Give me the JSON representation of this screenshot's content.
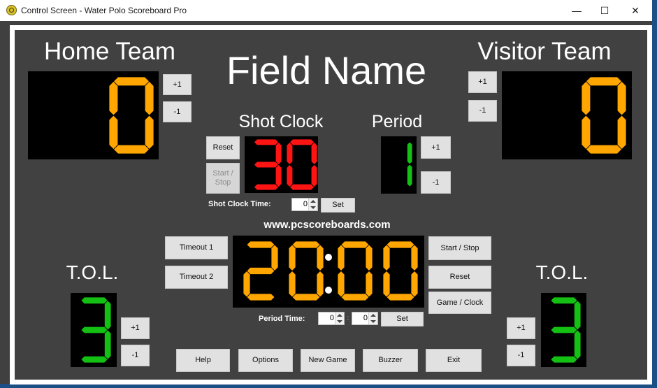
{
  "window": {
    "title": "Control Screen - Water Polo Scoreboard Pro",
    "controls": {
      "minimize": "—",
      "maximize": "☐",
      "close": "✕"
    }
  },
  "colors": {
    "score_digit": "#ffa600",
    "shot_clock_digit": "#ff1414",
    "period_digit": "#13c013",
    "tol_digit": "#13c013",
    "clock_digit": "#ffa600",
    "panel_bg": "#414141",
    "display_bg": "#000000"
  },
  "field_name": "Field Name",
  "home": {
    "label": "Home Team",
    "score": "0",
    "plus_label": "+1",
    "minus_label": "-1",
    "tol_label": "T.O.L.",
    "tol_value": "3",
    "tol_plus_label": "+1",
    "tol_minus_label": "-1"
  },
  "visitor": {
    "label": "Visitor Team",
    "score": "0",
    "plus_label": "+1",
    "minus_label": "-1",
    "tol_label": "T.O.L.",
    "tol_value": "3",
    "tol_plus_label": "+1",
    "tol_minus_label": "-1"
  },
  "shot_clock": {
    "label": "Shot Clock",
    "value": "30",
    "reset_label": "Reset",
    "start_stop_label": "Start / Stop",
    "time_label": "Shot Clock Time:",
    "time_value": "0",
    "set_label": "Set"
  },
  "period": {
    "label": "Period",
    "value": "1",
    "plus_label": "+1",
    "minus_label": "-1"
  },
  "website": "www.pcscoreboards.com",
  "game_clock": {
    "minutes": "20",
    "seconds": "00",
    "timeout1_label": "Timeout 1",
    "timeout2_label": "Timeout 2",
    "start_stop_label": "Start / Stop",
    "reset_label": "Reset",
    "game_clock_label": "Game / Clock",
    "period_time_label": "Period Time:",
    "period_minutes_value": "0",
    "period_seconds_value": "0",
    "separator": ":",
    "set_label": "Set"
  },
  "bottom_buttons": [
    "Help",
    "Options",
    "New Game",
    "Buzzer",
    "Exit"
  ]
}
